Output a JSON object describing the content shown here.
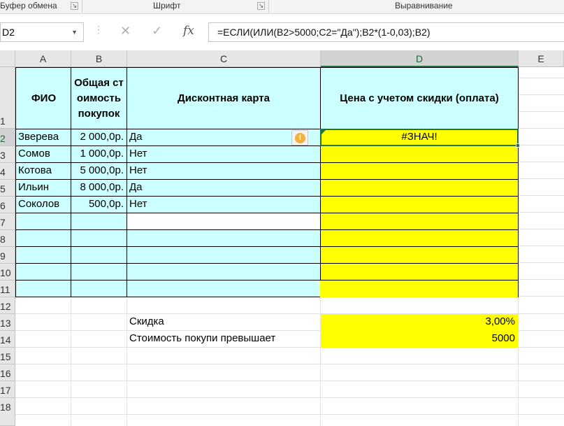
{
  "ribbon": {
    "clipboard": "Буфер обмена",
    "font": "Шрифт",
    "alignment": "Выравнивание"
  },
  "formula_bar": {
    "name_box": "D2",
    "cancel_icon": "✕",
    "enter_icon": "✓",
    "fx_label": "fx",
    "formula": "=ЕСЛИ(ИЛИ(B2>5000;C2=\"Да\");B2*(1-0,03);B2)"
  },
  "columns": [
    "A",
    "B",
    "C",
    "D",
    "E"
  ],
  "rows": [
    "1",
    "2",
    "3",
    "4",
    "5",
    "6",
    "7",
    "8",
    "9",
    "10",
    "11",
    "12",
    "13",
    "14",
    "15",
    "16",
    "17",
    "18"
  ],
  "header": {
    "a": "ФИО",
    "b": "Общая стоимость покупок",
    "c": "Дисконтная карта",
    "d": "Цена с учетом скидки (оплата)"
  },
  "table": [
    {
      "name": "Зверева",
      "total": "2 000,0р.",
      "card": "Да",
      "price": "#ЗНАЧ!"
    },
    {
      "name": "Сомов",
      "total": "1 000,0р.",
      "card": "Нет",
      "price": ""
    },
    {
      "name": "Котова",
      "total": "5 000,0р.",
      "card": "Нет",
      "price": ""
    },
    {
      "name": "Ильин",
      "total": "8 000,0р.",
      "card": "Да",
      "price": ""
    },
    {
      "name": "Соколов",
      "total": "500,0р.",
      "card": "Нет",
      "price": ""
    }
  ],
  "params": {
    "discount_label": "Скидка",
    "discount_value": "3,00%",
    "threshold_label": "Стоимость покупи превышает",
    "threshold_value": "5000"
  },
  "colors": {
    "cyan": "#ccffff",
    "yellow": "#ffff00",
    "accent": "#217346"
  }
}
